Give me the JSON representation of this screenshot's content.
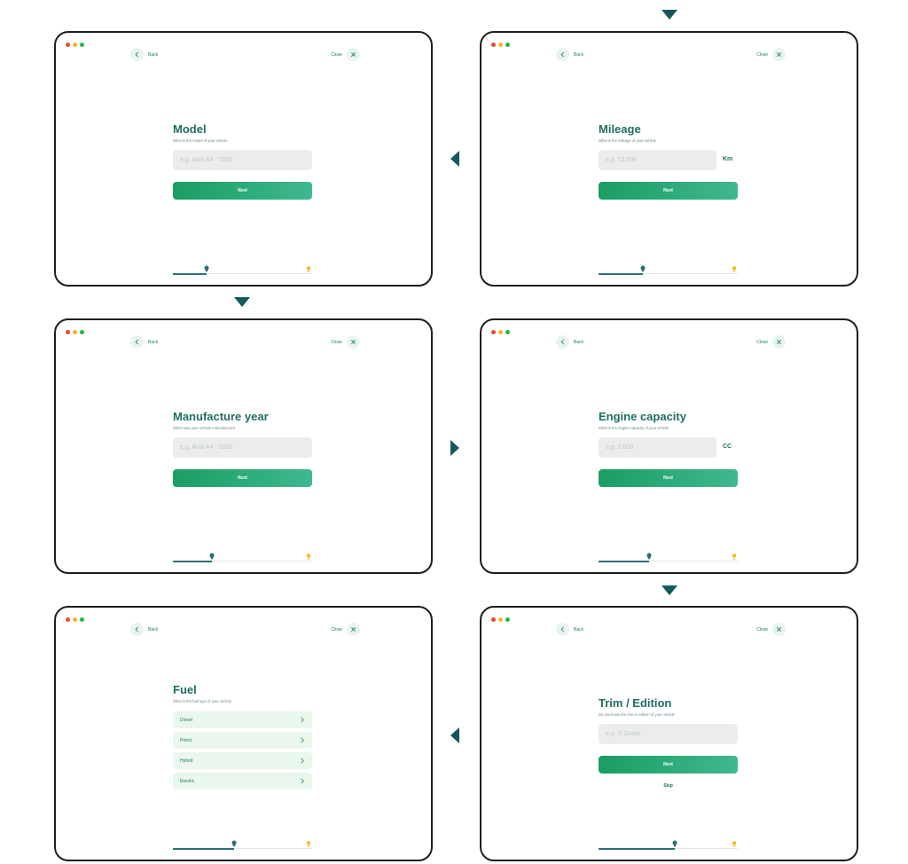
{
  "colors": {
    "accent": "#1a9e63",
    "title": "#1f6e61",
    "arrow": "#13595c",
    "dot_red": "#e5493a",
    "dot_yellow": "#f3b829",
    "dot_green": "#2bb24c"
  },
  "common": {
    "back_label": "Back",
    "close_label": "Close",
    "next_label": "Next"
  },
  "screens": [
    {
      "title": "Model",
      "subtitle": "What is the model of your vehicle",
      "placeholder": "e.g. Audi A4 - 2020",
      "progress": 0.24
    },
    {
      "title": "Mileage",
      "subtitle": "What is the mileage of your vehicle",
      "placeholder": "e.g. 10,000",
      "unit": "Km",
      "progress": 0.32
    },
    {
      "title": "Manufacture year",
      "subtitle": "When was your vehicle manufactured",
      "placeholder": "e.g. Audi A4 - 2020",
      "progress": 0.28
    },
    {
      "title": "Engine capacity",
      "subtitle": "What is the engine capacity of your vehicle",
      "placeholder": "e.g. 2,000",
      "unit": "CC",
      "progress": 0.36
    },
    {
      "title": "Fuel",
      "subtitle": "What is the fuel type of your vehicle",
      "options": [
        "Diesel",
        "Petrol",
        "Hybrid",
        "Electric"
      ],
      "progress": 0.44
    },
    {
      "title": "Trim / Edition",
      "subtitle": "Do you know the trim or edition of your vehicle",
      "placeholder": "e.g. S Grade",
      "skip_label": "Skip",
      "progress": 0.55
    }
  ]
}
